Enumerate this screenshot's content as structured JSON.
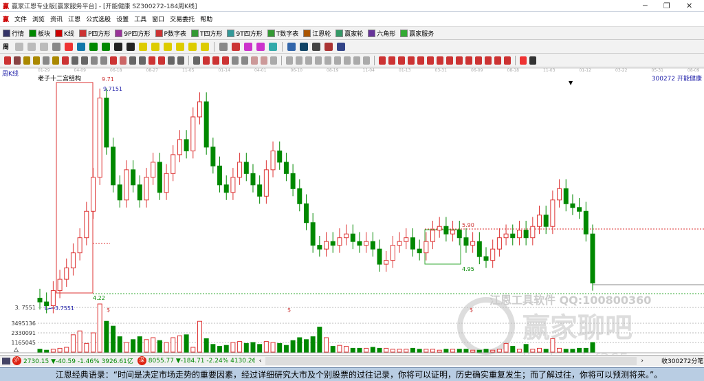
{
  "window": {
    "title": "赢家江恩专业版[赢家服务平台] - [开能健康  SZ300272-184周K线]",
    "min": "─",
    "max": "❐",
    "close": "✕"
  },
  "menu": [
    "文件",
    "浏览",
    "资讯",
    "江恩",
    "公式选股",
    "设置",
    "工具",
    "窗口",
    "交易委托",
    "帮助"
  ],
  "toolbar": [
    {
      "label": "行情",
      "color": "#336"
    },
    {
      "label": "板块",
      "color": "#080"
    },
    {
      "label": "K线",
      "color": "#c00"
    },
    {
      "label": "P四方形",
      "color": "#c33"
    },
    {
      "label": "9P四方形",
      "color": "#939"
    },
    {
      "label": "P数字表",
      "color": "#c33"
    },
    {
      "label": "T四方形",
      "color": "#393"
    },
    {
      "label": "9T四方形",
      "color": "#399"
    },
    {
      "label": "T数字表",
      "color": "#393"
    },
    {
      "label": "江恩轮",
      "color": "#a50"
    },
    {
      "label": "赢家轮",
      "color": "#396"
    },
    {
      "label": "六角形",
      "color": "#639"
    },
    {
      "label": "赢家服务",
      "color": "#3a3"
    }
  ],
  "period_button": "周",
  "chart": {
    "period_label": "周K线",
    "stock_label": "300272 开能健康",
    "study_title": "老子十二宫结构",
    "high_label": "9.71",
    "high_value": "9.7151",
    "low_value": "3.7551",
    "box_low": "4.22",
    "level_590": "5.90",
    "level_495": "4.95",
    "date_ticks": [
      "01-29",
      "04-09",
      "06-18",
      "08-27",
      "11-05",
      "01-14",
      "04-01",
      "06-10",
      "08-19",
      "11-04",
      "01-13",
      "03-31",
      "06-09",
      "08-18",
      "11-03",
      "01-12",
      "03-22",
      "05-31",
      "08-09"
    ],
    "vol_ticks": [
      "3495136",
      "2330091",
      "1165045"
    ],
    "price_tick": "3. 7551",
    "dollar_mark": "$",
    "watermark_top": "江恩工具软件  QQ:100800360",
    "watermark_main": "赢家聊吧",
    "watermark_url": "liaoba.yicf365.com"
  },
  "chart_data": {
    "type": "candlestick",
    "closes": [
      3.9,
      3.8,
      4.2,
      4.5,
      4.8,
      5.2,
      5.6,
      6.3,
      7.2,
      9.3,
      8.0,
      7.0,
      6.6,
      7.4,
      7.0,
      6.6,
      7.2,
      7.6,
      6.8,
      7.3,
      7.8,
      8.2,
      7.9,
      8.8,
      9.2,
      8.0,
      7.5,
      7.0,
      6.8,
      7.2,
      7.6,
      7.3,
      7.0,
      6.7,
      7.4,
      7.9,
      7.6,
      7.3,
      6.9,
      6.5,
      6.0,
      5.4,
      5.3,
      5.5,
      5.4,
      5.6,
      5.7,
      5.5,
      5.4,
      5.5,
      5.3,
      4.9,
      5.0,
      5.4,
      5.5,
      5.6,
      5.3,
      5.2,
      5.5,
      5.8,
      5.9,
      5.7,
      5.8,
      5.6,
      5.4,
      5.5,
      5.1,
      5.0,
      5.3,
      5.6,
      5.7,
      5.6,
      5.8,
      5.6,
      5.9,
      6.2,
      5.9,
      6.6,
      6.9,
      6.5,
      6.4,
      6.3,
      5.7,
      4.4
    ],
    "volumes": [
      0.3,
      0.2,
      0.3,
      0.4,
      0.5,
      1.8,
      2.2,
      0.9,
      2.0,
      5.0,
      3.2,
      2.7,
      1.6,
      1.0,
      1.3,
      1.6,
      1.3,
      1.5,
      1.2,
      1.0,
      1.5,
      1.7,
      1.8,
      0.5,
      3.2,
      1.4,
      0.8,
      0.6,
      0.7,
      1.0,
      1.1,
      0.9,
      1.0,
      0.8,
      1.1,
      1.0,
      0.9,
      0.7,
      1.2,
      1.5,
      1.3,
      1.6,
      2.6,
      1.5,
      0.6,
      0.7,
      0.6,
      0.4,
      0.4,
      0.4,
      0.5,
      0.4,
      0.4,
      0.3,
      0.3,
      0.3,
      0.4,
      0.3,
      0.3,
      0.3,
      0.2,
      0.3,
      0.3,
      0.3,
      0.3,
      0.2,
      0.2,
      0.3,
      0.2,
      0.3,
      0.9,
      0.6,
      0.3,
      0.8,
      0.3,
      0.4,
      0.3,
      1.4,
      0.4,
      0.3,
      0.3,
      0.4,
      0.4,
      1.0
    ],
    "ylim": [
      3.7551,
      9.71
    ]
  },
  "status": {
    "sh_label": "沪",
    "sh": "2730.15 ▼-40.59 -1.46% 3926.61亿",
    "sz_label": "深",
    "sz": "8055.77 ▼-184.71 -2.24% 4130.26",
    "right": "收300272分笔"
  },
  "quote": "江恩经典语录：“时间是决定市场走势的重要因素，经过详细研究大市及个别股票的过往记录，你将可以证明，历史确实重复发生；而了解过往，你将可以预测将来。”。"
}
